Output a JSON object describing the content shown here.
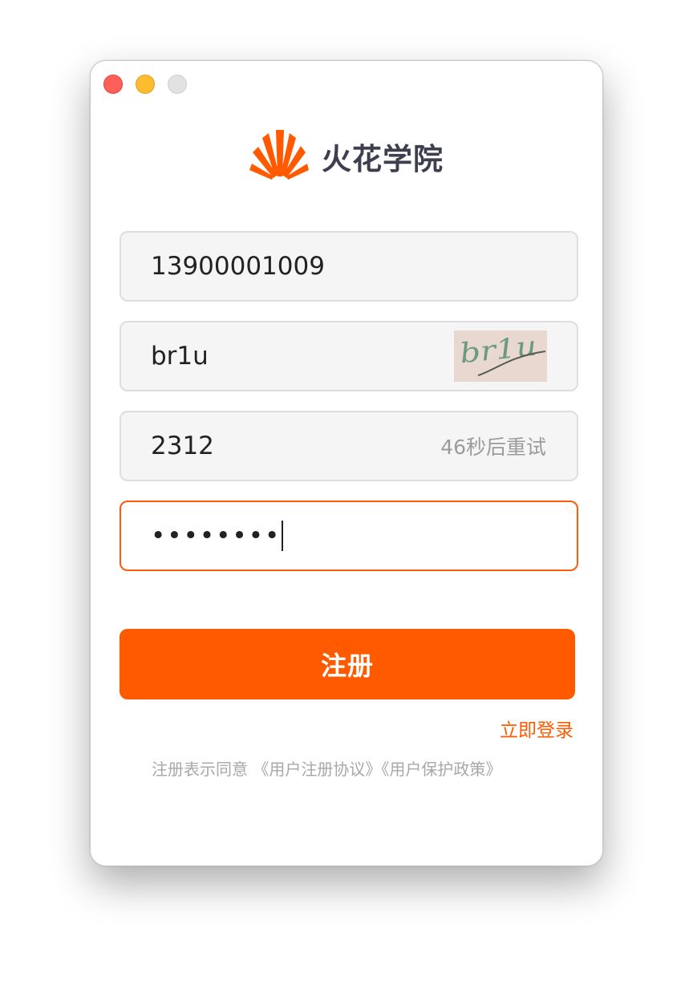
{
  "app": {
    "name": "火花学院"
  },
  "form": {
    "phone_value": "13900001009",
    "captcha_value": "br1u",
    "captcha_image_text": "br1u",
    "sms_code_value": "2312",
    "countdown_text": "46秒后重试",
    "password_masked": "••••••••"
  },
  "actions": {
    "register_label": "注册",
    "login_label": "立即登录"
  },
  "agreement": {
    "prefix": "注册表示同意",
    "user_agreement": "《用户注册协议》",
    "privacy_policy": "《用户保护政策》"
  },
  "colors": {
    "accent": "#ff5a00",
    "logo_text": "#3d3f4f",
    "traffic_close": "#fe5f57",
    "traffic_minimize": "#febc2e",
    "traffic_zoom": "#e2e2e2"
  }
}
